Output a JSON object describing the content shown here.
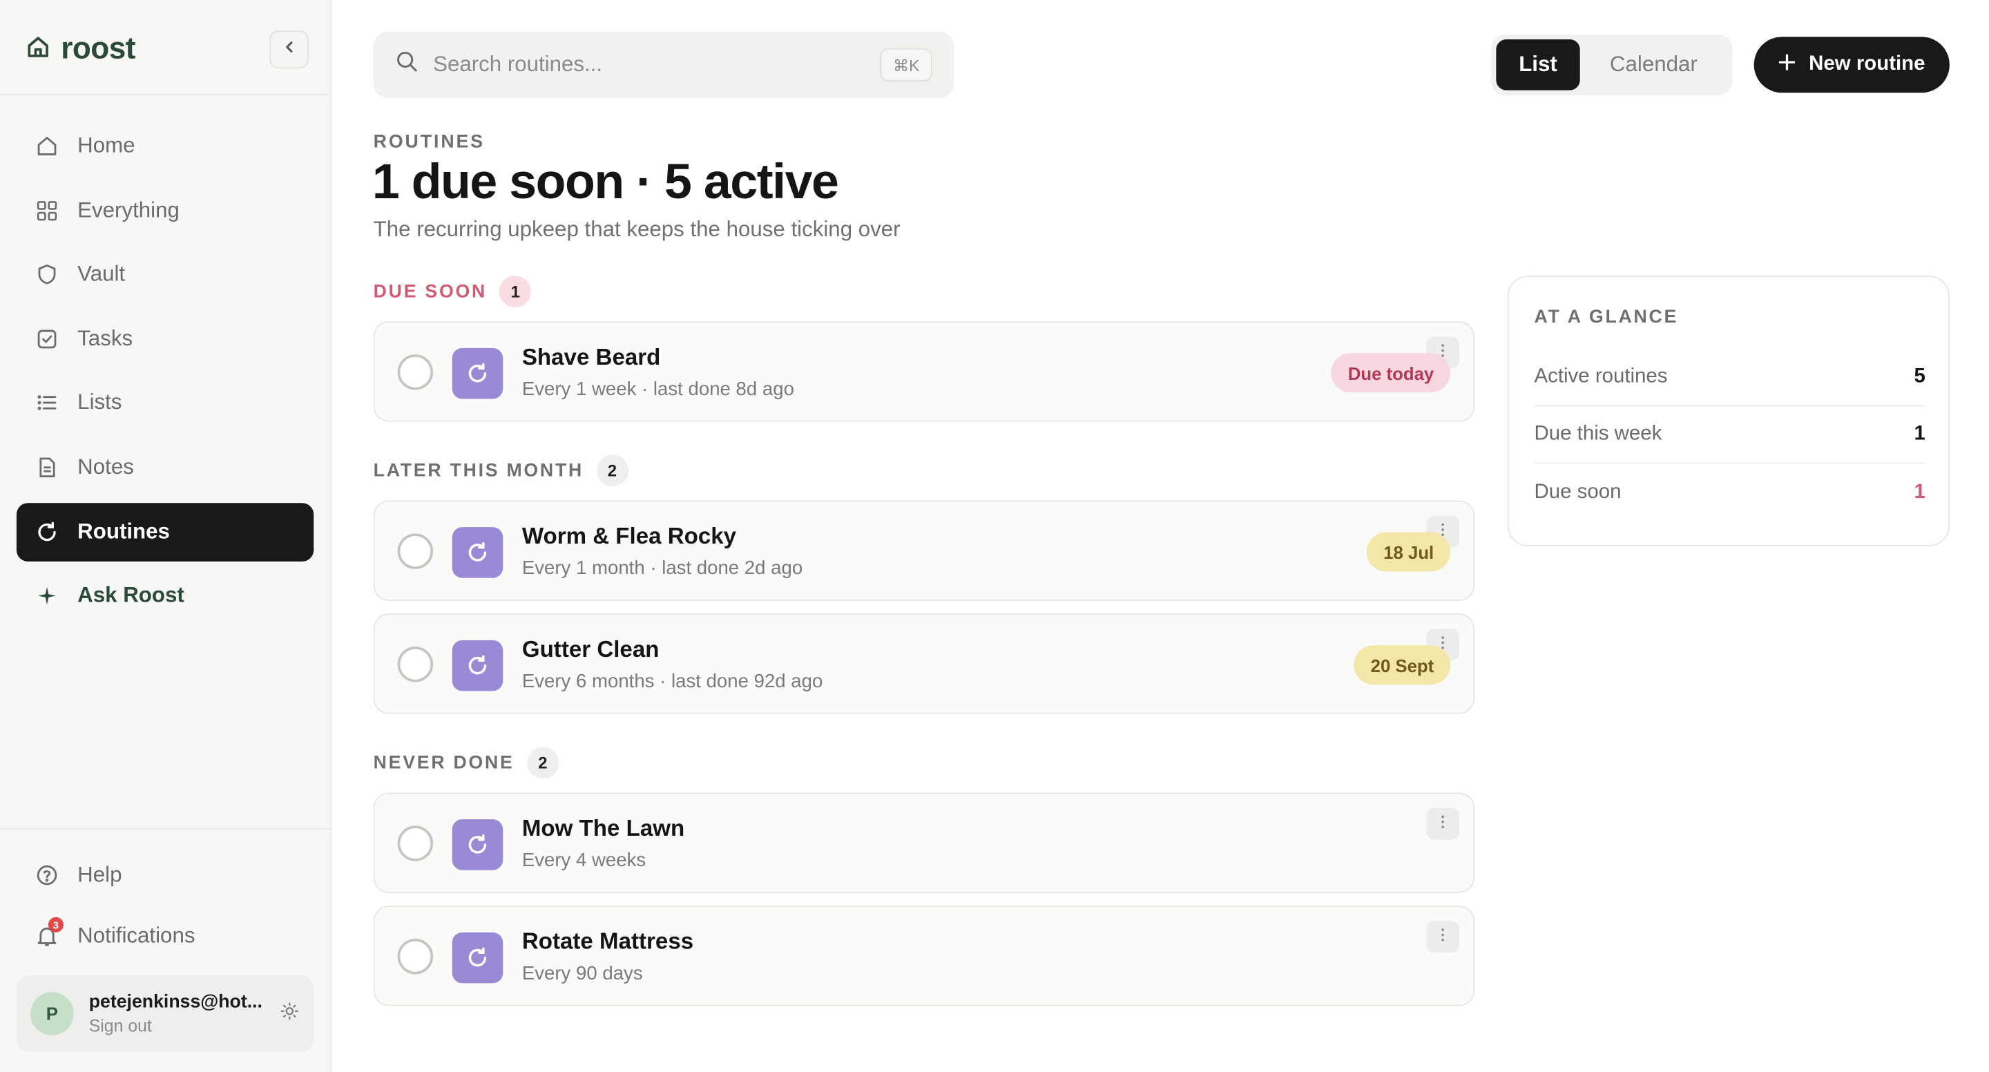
{
  "brand": {
    "name": "roost"
  },
  "sidebar": {
    "items": [
      {
        "label": "Home",
        "icon": "home-icon"
      },
      {
        "label": "Everything",
        "icon": "grid-icon"
      },
      {
        "label": "Vault",
        "icon": "shield-icon"
      },
      {
        "label": "Tasks",
        "icon": "checkbox-icon"
      },
      {
        "label": "Lists",
        "icon": "list-icon"
      },
      {
        "label": "Notes",
        "icon": "document-icon"
      },
      {
        "label": "Routines",
        "icon": "refresh-icon",
        "active": true
      },
      {
        "label": "Ask Roost",
        "icon": "sparkle-icon"
      }
    ],
    "bottom": [
      {
        "label": "Help",
        "icon": "help-icon"
      },
      {
        "label": "Notifications",
        "icon": "bell-icon",
        "badge": "3"
      }
    ],
    "user": {
      "initial": "P",
      "email": "petejenkinss@hot...",
      "sign_out": "Sign out"
    }
  },
  "search": {
    "placeholder": "Search routines...",
    "shortcut": "⌘K"
  },
  "view_toggle": {
    "list": "List",
    "calendar": "Calendar",
    "selected": "List"
  },
  "new_button": {
    "label": "New routine"
  },
  "header": {
    "eyebrow": "ROUTINES",
    "title": "1 due soon · 5 active",
    "subtitle": "The recurring upkeep that keeps the house ticking over"
  },
  "sections": [
    {
      "label": "DUE SOON",
      "count": "1",
      "routines": [
        {
          "title": "Shave Beard",
          "meta": "Every 1 week · last done 8d ago",
          "due": "Due today",
          "due_style": "red"
        }
      ]
    },
    {
      "label": "LATER THIS MONTH",
      "count": "2",
      "routines": [
        {
          "title": "Worm & Flea Rocky",
          "meta": "Every 1 month · last done 2d ago",
          "due": "18 Jul",
          "due_style": "yellow"
        },
        {
          "title": "Gutter Clean",
          "meta": "Every 6 months · last done 92d ago",
          "due": "20 Sept",
          "due_style": "yellow"
        }
      ]
    },
    {
      "label": "NEVER DONE",
      "count": "2",
      "routines": [
        {
          "title": "Mow The Lawn",
          "meta": "Every 4 weeks"
        },
        {
          "title": "Rotate Mattress",
          "meta": "Every 90 days"
        }
      ]
    }
  ],
  "glance": {
    "title": "AT A GLANCE",
    "rows": [
      {
        "label": "Active routines",
        "value": "5"
      },
      {
        "label": "Due this week",
        "value": "1"
      },
      {
        "label": "Due soon",
        "value": "1"
      }
    ]
  },
  "colors": {
    "accent_dark": "#17191a",
    "brand_green": "#2c4a3a",
    "routine_icon": "#9a8ad6",
    "due_red": "#d05a72",
    "due_yellow": "#f4e6a8"
  }
}
